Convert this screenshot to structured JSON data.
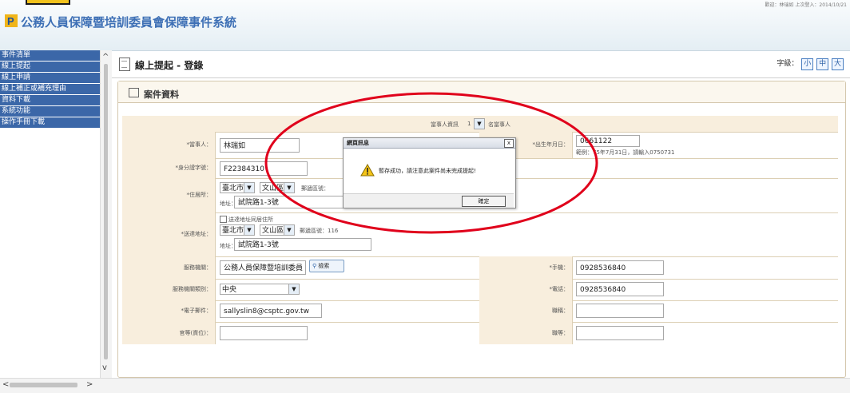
{
  "header": {
    "system_title": "公務人員保障暨培訓委員會保障事件系統",
    "top_right_text": "歡迎：林瑞如 上次登入：2014/10/21"
  },
  "sidebar": {
    "items": [
      {
        "label": "事件清單"
      },
      {
        "label": "線上提起"
      },
      {
        "label": "線上申請"
      },
      {
        "label": "線上補正或補充理由"
      },
      {
        "label": "資料下載"
      },
      {
        "label": "系統功能"
      },
      {
        "label": "操作手冊下載"
      }
    ]
  },
  "page": {
    "title": "線上提起 - 登錄",
    "font_size_label": "字級：",
    "font_sizes": [
      "小",
      "中",
      "大"
    ]
  },
  "panel": {
    "title": "案件資料"
  },
  "form": {
    "row0": {
      "text_a": "當事人資訊",
      "count": "1",
      "text_b": "名當事人"
    },
    "name_label": "*當事人：",
    "name_value": "林瑞如",
    "birth_label": "*出生年月日：",
    "birth_value": "0661122",
    "birth_hint": "範例：75年7月31日，請輸入0750731",
    "id_label": "*身分證字號：",
    "id_value": "F22384310",
    "residence_label": "*住居所：",
    "residence_city": "臺北市",
    "residence_district": "文山區",
    "residence_postal_label": "郵遞區號：",
    "residence_addr_label": "地址：",
    "residence_addr": "試院路1-3號",
    "same_as_residence": "送達地址同居住所",
    "mail_label": "*送達地址：",
    "mail_city": "臺北市",
    "mail_district": "文山區",
    "mail_postal": "郵遞區號：116",
    "mail_addr_label": "地址：",
    "mail_addr": "試院路1-3號",
    "agency_label": "服務機關：",
    "agency_value": "公務人員保障暨培訓委員",
    "search_label": "檢索",
    "mobile_label": "*手機：",
    "mobile_value": "0928536840",
    "agency_cat_label": "服務機關類別：",
    "agency_cat_value": "中央",
    "phone_label": "*電話：",
    "phone_value": "0928536840",
    "email_label": "*電子郵件：",
    "email_value": "sallyslin8@csptc.gov.tw",
    "title_label": "職稱：",
    "rank_label": "官等(資位)：",
    "grade_label": "職等："
  },
  "dialog": {
    "title": "網頁訊息",
    "message": "暫存成功，請注意此案件尚未完成提起!",
    "ok_label": "確定",
    "close_label": "x"
  },
  "colors": {
    "sidebar_bg": "#3b67a8",
    "label_bg": "#f8eedd",
    "annotation_red": "#e0001b",
    "title_blue": "#3d6fb5"
  }
}
